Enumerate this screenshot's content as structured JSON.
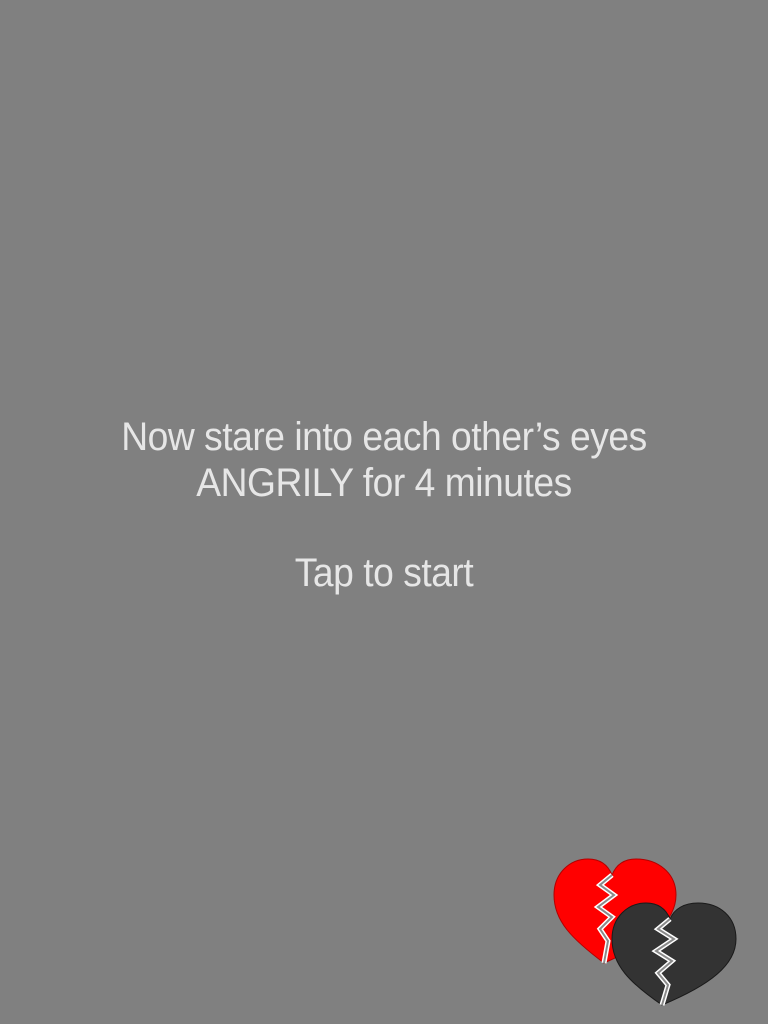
{
  "screen": {
    "instruction_line1": "Now stare into each other’s eyes",
    "instruction_line2": "ANGRILY for 4 minutes",
    "tap_prompt": "Tap to start"
  },
  "logo": {
    "icon": "broken-hearts-icon",
    "colors": {
      "background": "#808080",
      "text": "#e6e6e6",
      "red_heart": "#ff0000",
      "dark_heart": "#333333"
    }
  }
}
